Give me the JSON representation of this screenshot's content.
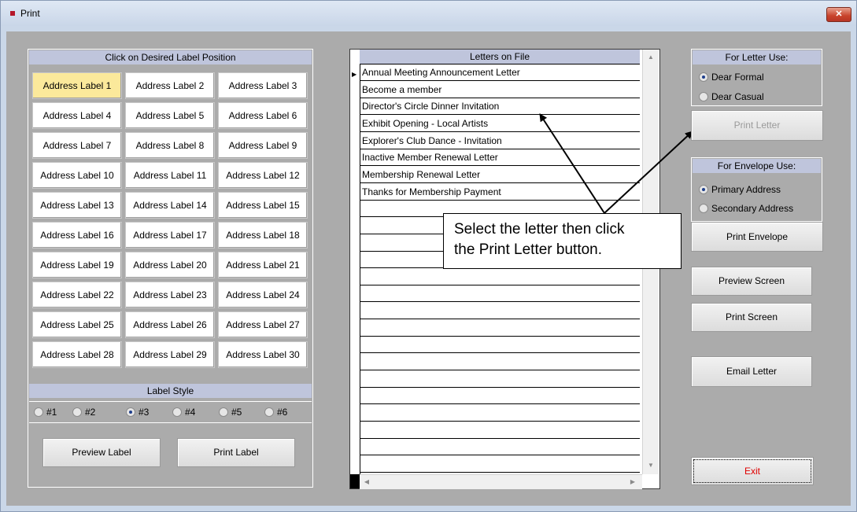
{
  "window": {
    "title": "Print",
    "close_label": "x"
  },
  "labels": {
    "header": "Click on Desired Label Position",
    "buttons": [
      "Address Label 1",
      "Address Label 2",
      "Address Label 3",
      "Address Label 4",
      "Address Label 5",
      "Address Label 6",
      "Address Label 7",
      "Address Label 8",
      "Address Label 9",
      "Address Label 10",
      "Address Label 11",
      "Address Label 12",
      "Address Label 13",
      "Address Label 14",
      "Address Label 15",
      "Address Label 16",
      "Address Label 17",
      "Address Label 18",
      "Address Label 19",
      "Address Label 20",
      "Address Label 21",
      "Address Label 22",
      "Address Label 23",
      "Address Label 24",
      "Address Label 25",
      "Address Label 26",
      "Address Label 27",
      "Address Label 28",
      "Address Label 29",
      "Address Label 30"
    ],
    "selected_index": 0,
    "style_header": "Label Style",
    "style_options": [
      "#1",
      "#2",
      "#3",
      "#4",
      "#5",
      "#6"
    ],
    "style_selected": "#3",
    "preview_label": "Preview Label",
    "print_label": "Print Label"
  },
  "letters": {
    "header": "Letters on File",
    "items": [
      "Annual Meeting Announcement Letter",
      "Become a member",
      "Director's Circle Dinner Invitation",
      "Exhibit Opening - Local Artists",
      "Explorer's Club Dance - Invitation",
      "Inactive Member Renewal Letter",
      "Membership Renewal Letter",
      "Thanks for Membership Payment"
    ]
  },
  "callout": {
    "line1": "Select the letter then click",
    "line2": "the Print Letter button."
  },
  "letter_use": {
    "header": "For Letter Use:",
    "options": [
      "Dear Formal",
      "Dear Casual"
    ],
    "selected": "Dear Formal",
    "print_letter": "Print  Letter"
  },
  "envelope_use": {
    "header": "For Envelope Use:",
    "options": [
      "Primary Address",
      "Secondary Address"
    ],
    "selected": "Primary Address",
    "print_envelope": "Print Envelope"
  },
  "actions": {
    "preview_screen": "Preview Screen",
    "print_screen": "Print Screen",
    "email_letter": "Email Letter",
    "exit": "Exit"
  },
  "colors": {
    "exit_text": "#e00000",
    "selected_label": "#fbe99b",
    "header_bg": "#bfc5dc",
    "disabled_text": "#9a9a9a"
  }
}
